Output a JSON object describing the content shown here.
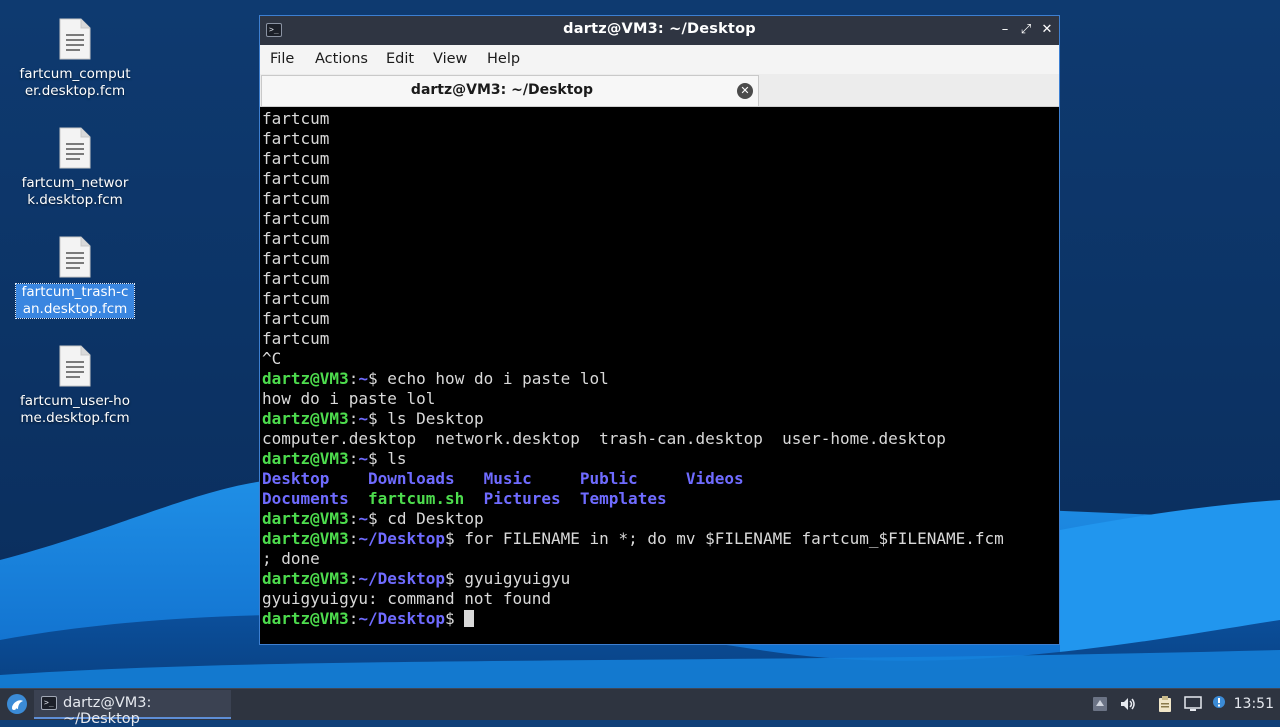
{
  "desktop": {
    "icons": [
      {
        "label": "fartcum_computer.desktop.fcm",
        "selected": false
      },
      {
        "label": "fartcum_network.desktop.fcm",
        "selected": false
      },
      {
        "label": "fartcum_trash-can.desktop.fcm",
        "selected": true
      },
      {
        "label": "fartcum_user-home.desktop.fcm",
        "selected": false
      }
    ]
  },
  "window": {
    "title": "dartz@VM3: ~/Desktop",
    "controls": {
      "minimize": "–",
      "maximize": "⤢",
      "close": "✕"
    },
    "menu": [
      "File",
      "Actions",
      "Edit",
      "View",
      "Help"
    ],
    "tab": {
      "label": "dartz@VM3: ~/Desktop",
      "close": "✕"
    }
  },
  "terminal": {
    "user_host": "dartz@VM3",
    "lines": [
      {
        "t": "out",
        "text": "fartcum"
      },
      {
        "t": "out",
        "text": "fartcum"
      },
      {
        "t": "out",
        "text": "fartcum"
      },
      {
        "t": "out",
        "text": "fartcum"
      },
      {
        "t": "out",
        "text": "fartcum"
      },
      {
        "t": "out",
        "text": "fartcum"
      },
      {
        "t": "out",
        "text": "fartcum"
      },
      {
        "t": "out",
        "text": "fartcum"
      },
      {
        "t": "out",
        "text": "fartcum"
      },
      {
        "t": "out",
        "text": "fartcum"
      },
      {
        "t": "out",
        "text": "fartcum"
      },
      {
        "t": "out",
        "text": "fartcum"
      },
      {
        "t": "out",
        "text": "^C"
      },
      {
        "t": "prompt",
        "path": "~",
        "cmd": " echo how do i paste lol"
      },
      {
        "t": "out",
        "text": "how do i paste lol"
      },
      {
        "t": "prompt",
        "path": "~",
        "cmd": " ls Desktop"
      },
      {
        "t": "out",
        "text": "computer.desktop  network.desktop  trash-can.desktop  user-home.desktop"
      },
      {
        "t": "prompt",
        "path": "~",
        "cmd": " ls"
      },
      {
        "t": "ls",
        "items": [
          {
            "text": "Desktop    ",
            "kind": "dir"
          },
          {
            "text": "Downloads   ",
            "kind": "dir"
          },
          {
            "text": "Music     ",
            "kind": "dir"
          },
          {
            "text": "Public     ",
            "kind": "dir"
          },
          {
            "text": "Videos",
            "kind": "dir"
          }
        ]
      },
      {
        "t": "ls",
        "items": [
          {
            "text": "Documents  ",
            "kind": "dir"
          },
          {
            "text": "fartcum.sh  ",
            "kind": "exec"
          },
          {
            "text": "Pictures  ",
            "kind": "dir"
          },
          {
            "text": "Templates",
            "kind": "dir"
          }
        ]
      },
      {
        "t": "prompt",
        "path": "~",
        "cmd": " cd Desktop"
      },
      {
        "t": "prompt",
        "path": "~/Desktop",
        "cmd": " for FILENAME in *; do mv $FILENAME fartcum_$FILENAME.fcm"
      },
      {
        "t": "out",
        "text": "; done"
      },
      {
        "t": "prompt",
        "path": "~/Desktop",
        "cmd": " gyuigyuigyu"
      },
      {
        "t": "out",
        "text": "gyuigyuigyu: command not found"
      },
      {
        "t": "prompt",
        "path": "~/Desktop",
        "cmd": " ",
        "cursor": true
      }
    ]
  },
  "taskbar": {
    "task_label": "dartz@VM3: ~/Desktop",
    "clock": "13:51"
  },
  "colors": {
    "prompt_user": "#4ddc4d",
    "prompt_path": "#6f6bff",
    "terminal_text": "#d9d9d9",
    "window_border": "#3d7fd1"
  }
}
